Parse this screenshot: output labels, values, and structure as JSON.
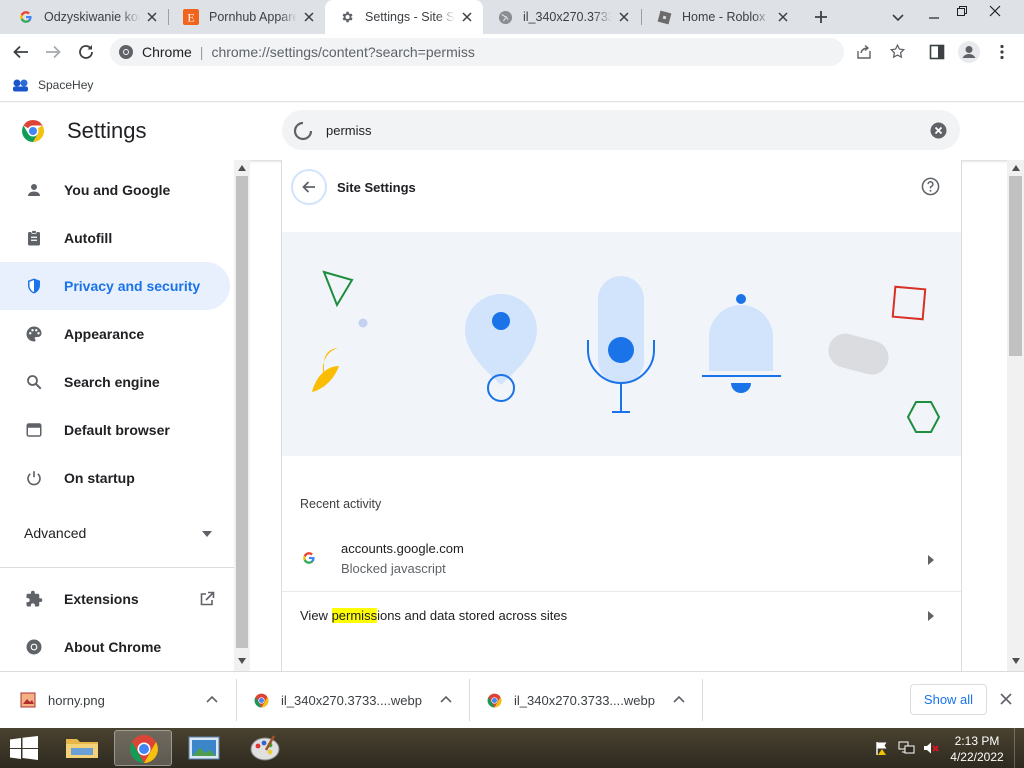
{
  "tabs": [
    {
      "title": "Odzyskiwanie kor",
      "favicon": "google-g-icon"
    },
    {
      "title": "Pornhub Apparel",
      "favicon": "etsy-e-icon"
    },
    {
      "title": "Settings - Site Set",
      "favicon": "gear-icon",
      "active": true
    },
    {
      "title": "il_340x270.37337",
      "favicon": "globe-icon"
    },
    {
      "title": "Home - Roblox",
      "favicon": "roblox-icon"
    }
  ],
  "toolbar": {
    "site_label": "Chrome",
    "url": "chrome://settings/content?search=permiss"
  },
  "bookmarks": [
    {
      "label": "SpaceHey"
    }
  ],
  "header": {
    "title": "Settings",
    "search_value": "permiss"
  },
  "sidebar": {
    "items": [
      {
        "label": "You and Google",
        "icon": "person-icon"
      },
      {
        "label": "Autofill",
        "icon": "clipboard-icon"
      },
      {
        "label": "Privacy and security",
        "icon": "shield-icon",
        "selected": true
      },
      {
        "label": "Appearance",
        "icon": "palette-icon"
      },
      {
        "label": "Search engine",
        "icon": "search-icon"
      },
      {
        "label": "Default browser",
        "icon": "browser-icon"
      },
      {
        "label": "On startup",
        "icon": "power-icon"
      }
    ],
    "advanced": "Advanced",
    "extensions": "Extensions",
    "about": "About Chrome"
  },
  "site_settings": {
    "title": "Site Settings",
    "recent_activity_heading": "Recent activity",
    "recent": {
      "site": "accounts.google.com",
      "detail": "Blocked javascript"
    },
    "view_prefix": "View ",
    "view_highlight": "permiss",
    "view_suffix": "ions and data stored across sites"
  },
  "downloads": {
    "items": [
      {
        "name": "horny.png"
      },
      {
        "name": "il_340x270.3733....webp"
      },
      {
        "name": "il_340x270.3733....webp"
      }
    ],
    "show_all": "Show all"
  },
  "taskbar": {
    "time": "2:13 PM",
    "date": "4/22/2022"
  },
  "colors": {
    "accent": "#1a73e8",
    "highlight": "#ffff00",
    "illustration_bg": "#f1f5fa",
    "illustration_blue": "#d2e3fc"
  }
}
